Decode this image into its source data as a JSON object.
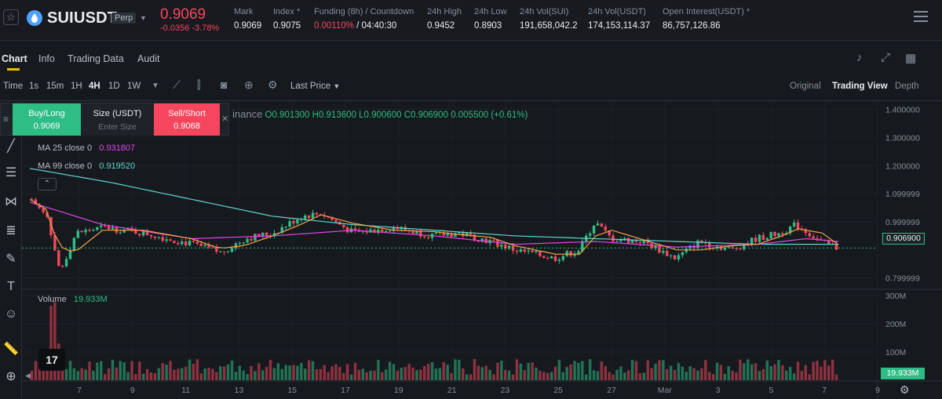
{
  "header": {
    "symbol": "SUIUSDT",
    "contract_badge": "Perp",
    "last_price": "0.9069",
    "change": "-0.0356 -3.78%",
    "stats": [
      {
        "label": "Mark",
        "value": "0.9069"
      },
      {
        "label": "Index *",
        "value": "0.9075"
      },
      {
        "label": "Funding (8h) / Countdown",
        "value_red": "0.00110%",
        "value": " / 04:40:30"
      },
      {
        "label": "24h High",
        "value": "0.9452"
      },
      {
        "label": "24h Low",
        "value": "0.8903"
      },
      {
        "label": "24h Vol(SUI)",
        "value": "191,658,042.2"
      },
      {
        "label": "24h Vol(USDT)",
        "value": "174,153,114.37"
      },
      {
        "label": "Open Interest(USDT) *",
        "value": "86,757,126.86"
      }
    ]
  },
  "tabs": [
    "Chart",
    "Info",
    "Trading Data",
    "Audit"
  ],
  "toolbar": {
    "time_label": "Time",
    "intervals": [
      "1s",
      "15m",
      "1H",
      "4H",
      "1D",
      "1W"
    ],
    "active_interval": "4H",
    "price_type": "Last Price",
    "views": [
      "Original",
      "Trading View",
      "Depth"
    ],
    "active_view": "Trading View"
  },
  "order_panel": {
    "buy_label": "Buy/Long",
    "buy_price": "0.9069",
    "size_label": "Size (USDT)",
    "size_placeholder": "Enter Size",
    "sell_label": "Sell/Short",
    "sell_price": "0.9068"
  },
  "legend": {
    "exchange": "inance",
    "open": "O0.901300",
    "high": "H0.913600",
    "low": "L0.900600",
    "close": "C0.906900",
    "change": "0.005500 (+0.61%)",
    "ma25_label": "MA 25 close 0",
    "ma25_value": "0.931807",
    "ma99_label": "MA 99 close 0",
    "ma99_value": "0.919520",
    "volume_label": "Volume",
    "volume_value": "19.933M"
  },
  "current_price_tag": "0.906900",
  "current_volume_tag": "19.933M",
  "tv_logo": "17",
  "colors": {
    "up": "#2ebd85",
    "down": "#f6465d",
    "ma_short": "#f0a24b",
    "ma25": "#e046e8",
    "ma99": "#5fd5ce",
    "accent": "#f0b90b"
  },
  "chart_data": {
    "type": "candlestick",
    "interval": "4H",
    "price_axis_ticks": [
      "1.400000",
      "1.300000",
      "1.200000",
      "1.099999",
      "0.999999",
      "0.906900",
      "0.799999"
    ],
    "price_range": [
      0.76,
      1.41
    ],
    "volume_axis_ticks": [
      "300M",
      "200M",
      "100M"
    ],
    "x_tick_labels": [
      "7",
      "9",
      "11",
      "13",
      "15",
      "17",
      "19",
      "21",
      "23",
      "25",
      "27",
      "Mar",
      "3",
      "5",
      "7",
      "9"
    ],
    "price_path": [
      [
        0.0,
        1.08
      ],
      [
        0.02,
        1.01
      ],
      [
        0.035,
        0.82
      ],
      [
        0.055,
        0.96
      ],
      [
        0.09,
        0.98
      ],
      [
        0.14,
        0.96
      ],
      [
        0.2,
        0.92
      ],
      [
        0.235,
        0.89
      ],
      [
        0.265,
        0.94
      ],
      [
        0.3,
        0.96
      ],
      [
        0.335,
        1.02
      ],
      [
        0.36,
        1.03
      ],
      [
        0.4,
        0.96
      ],
      [
        0.45,
        0.98
      ],
      [
        0.5,
        0.95
      ],
      [
        0.53,
        0.96
      ],
      [
        0.57,
        0.93
      ],
      [
        0.6,
        0.9
      ],
      [
        0.65,
        0.87
      ],
      [
        0.68,
        0.9
      ],
      [
        0.7,
        1.0
      ],
      [
        0.72,
        0.94
      ],
      [
        0.76,
        0.93
      ],
      [
        0.8,
        0.87
      ],
      [
        0.83,
        0.93
      ],
      [
        0.87,
        0.9
      ],
      [
        0.9,
        0.94
      ],
      [
        0.93,
        0.96
      ],
      [
        0.95,
        0.99
      ],
      [
        0.98,
        0.93
      ],
      [
        1.0,
        0.907
      ]
    ],
    "ma25_path": [
      [
        0.0,
        1.07
      ],
      [
        0.09,
        0.99
      ],
      [
        0.2,
        0.94
      ],
      [
        0.3,
        0.95
      ],
      [
        0.4,
        0.97
      ],
      [
        0.5,
        0.95
      ],
      [
        0.6,
        0.92
      ],
      [
        0.7,
        0.93
      ],
      [
        0.8,
        0.91
      ],
      [
        0.9,
        0.92
      ],
      [
        0.96,
        0.94
      ],
      [
        1.0,
        0.93
      ]
    ],
    "ma99_path": [
      [
        0.0,
        1.19
      ],
      [
        0.1,
        1.14
      ],
      [
        0.2,
        1.08
      ],
      [
        0.3,
        1.02
      ],
      [
        0.4,
        0.99
      ],
      [
        0.5,
        0.97
      ],
      [
        0.6,
        0.95
      ],
      [
        0.7,
        0.94
      ],
      [
        0.8,
        0.93
      ],
      [
        0.9,
        0.92
      ],
      [
        1.0,
        0.92
      ]
    ],
    "volume_peak_M": 300,
    "last_volume_M": 19.933
  }
}
